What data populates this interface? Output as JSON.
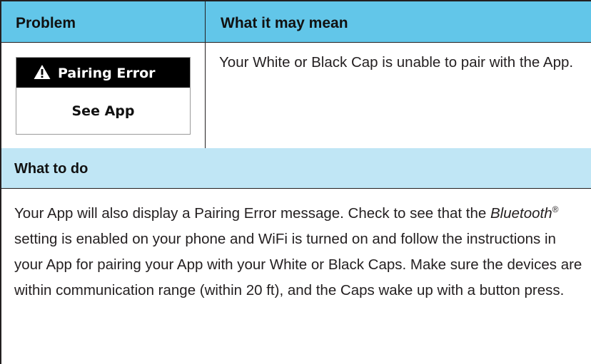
{
  "header": {
    "problem_label": "Problem",
    "meaning_label": "What it may mean"
  },
  "problem": {
    "icon": "warning-triangle-icon",
    "error_text": "Pairing Error",
    "sub_text": "See App"
  },
  "meaning": {
    "text": "Your White or Black Cap is unable to pair with the App."
  },
  "what_to_do": {
    "title": "What to do",
    "text_part1": "Your App will also display a Pairing Error message. Check to see that the ",
    "bluetooth": "Bluetooth",
    "registered": "®",
    "text_part2": " setting is enabled on your phone and WiFi is turned on and follow the instructions in your App for pairing your App with your White or Black Caps. Make sure the devices are within communication range (within 20 ft), and the Caps wake up with a button press."
  },
  "colors": {
    "header_bg": "#62c6e9",
    "subheader_bg": "#c0e6f5",
    "border": "#231f20",
    "text": "#231f20"
  }
}
